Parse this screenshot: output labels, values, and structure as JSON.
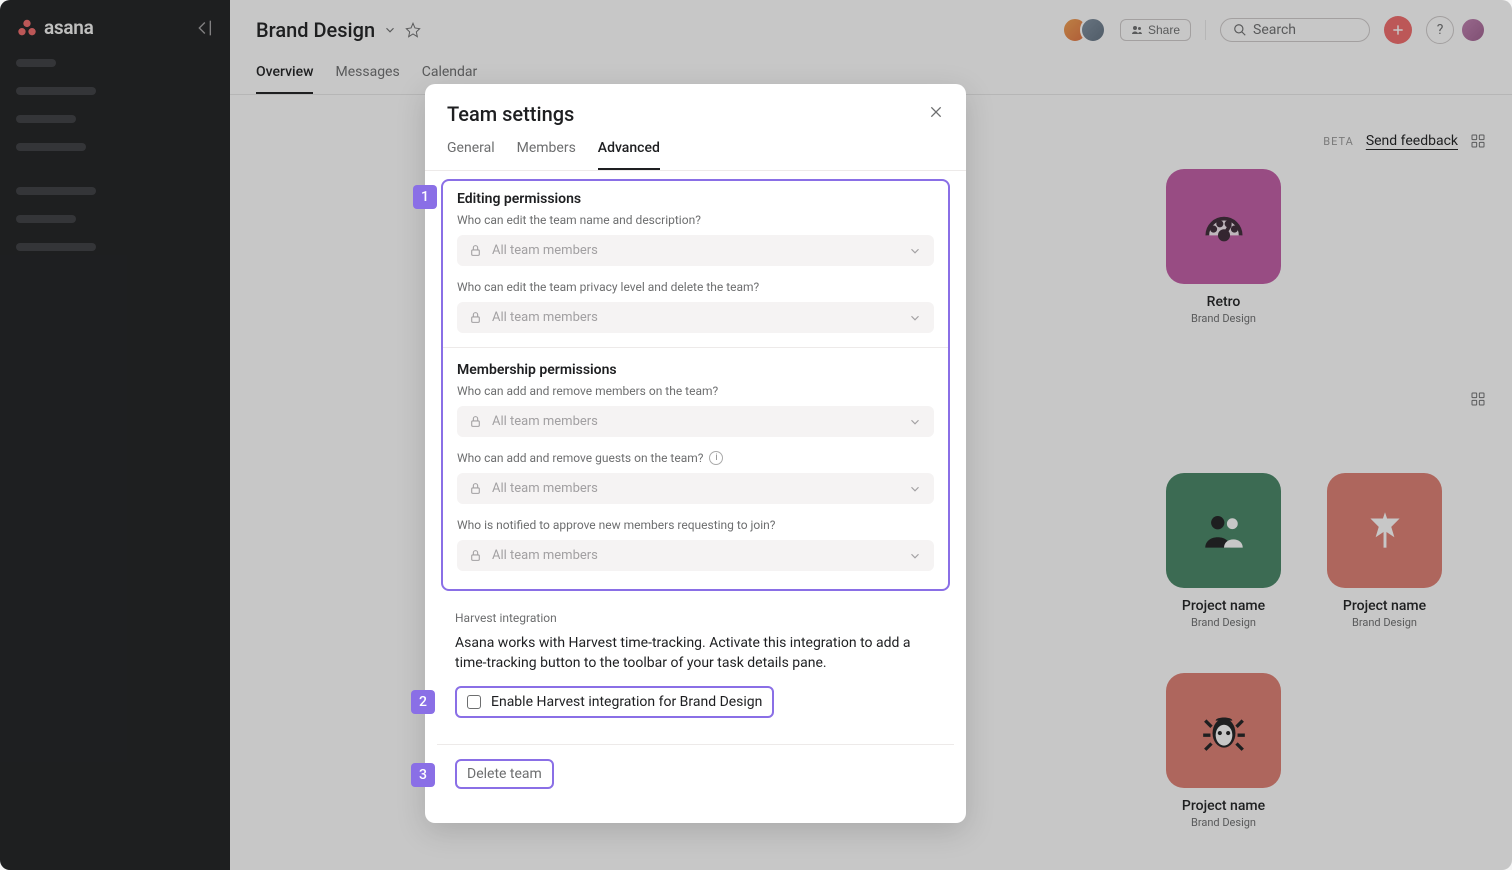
{
  "brand": "asana",
  "header": {
    "title": "Brand Design",
    "share_label": "Share",
    "search_placeholder": "Search",
    "tabs": [
      "Overview",
      "Messages",
      "Calendar"
    ],
    "active_tab": 0
  },
  "beta_row": {
    "beta": "BETA",
    "send_feedback": "Send feedback"
  },
  "projects": [
    {
      "name": "Retro",
      "subtitle": "Brand Design",
      "tile_class": "tile-pink",
      "icon": "gauge"
    },
    {
      "name": "Project name",
      "subtitle": "Brand Design",
      "tile_class": "tile-green",
      "icon": "people"
    },
    {
      "name": "Project name",
      "subtitle": "Brand Design",
      "tile_class": "tile-red",
      "icon": "flag"
    },
    {
      "name": "Project name",
      "subtitle": "Brand Design",
      "tile_class": "tile-red2",
      "icon": "bug"
    }
  ],
  "modal": {
    "title": "Team settings",
    "tabs": [
      "General",
      "Members",
      "Advanced"
    ],
    "active_tab": 2,
    "sections": {
      "editing": {
        "heading": "Editing permissions",
        "q1": "Who can edit the team name and description?",
        "q2": "Who can edit the team privacy level and delete the team?",
        "value": "All team members"
      },
      "membership": {
        "heading": "Membership permissions",
        "q1": "Who can add and remove members on the team?",
        "q2": "Who can add and remove guests on the team?",
        "q3": "Who is notified to approve new members requesting to join?",
        "value": "All team members"
      }
    },
    "harvest": {
      "title": "Harvest integration",
      "description": "Asana works with Harvest time-tracking.  Activate this integration to add a time-tracking button to the toolbar of your task details pane.",
      "checkbox_label": "Enable Harvest integration for Brand Design"
    },
    "delete_label": "Delete team",
    "annotations": {
      "a1": "1",
      "a2": "2",
      "a3": "3"
    }
  }
}
